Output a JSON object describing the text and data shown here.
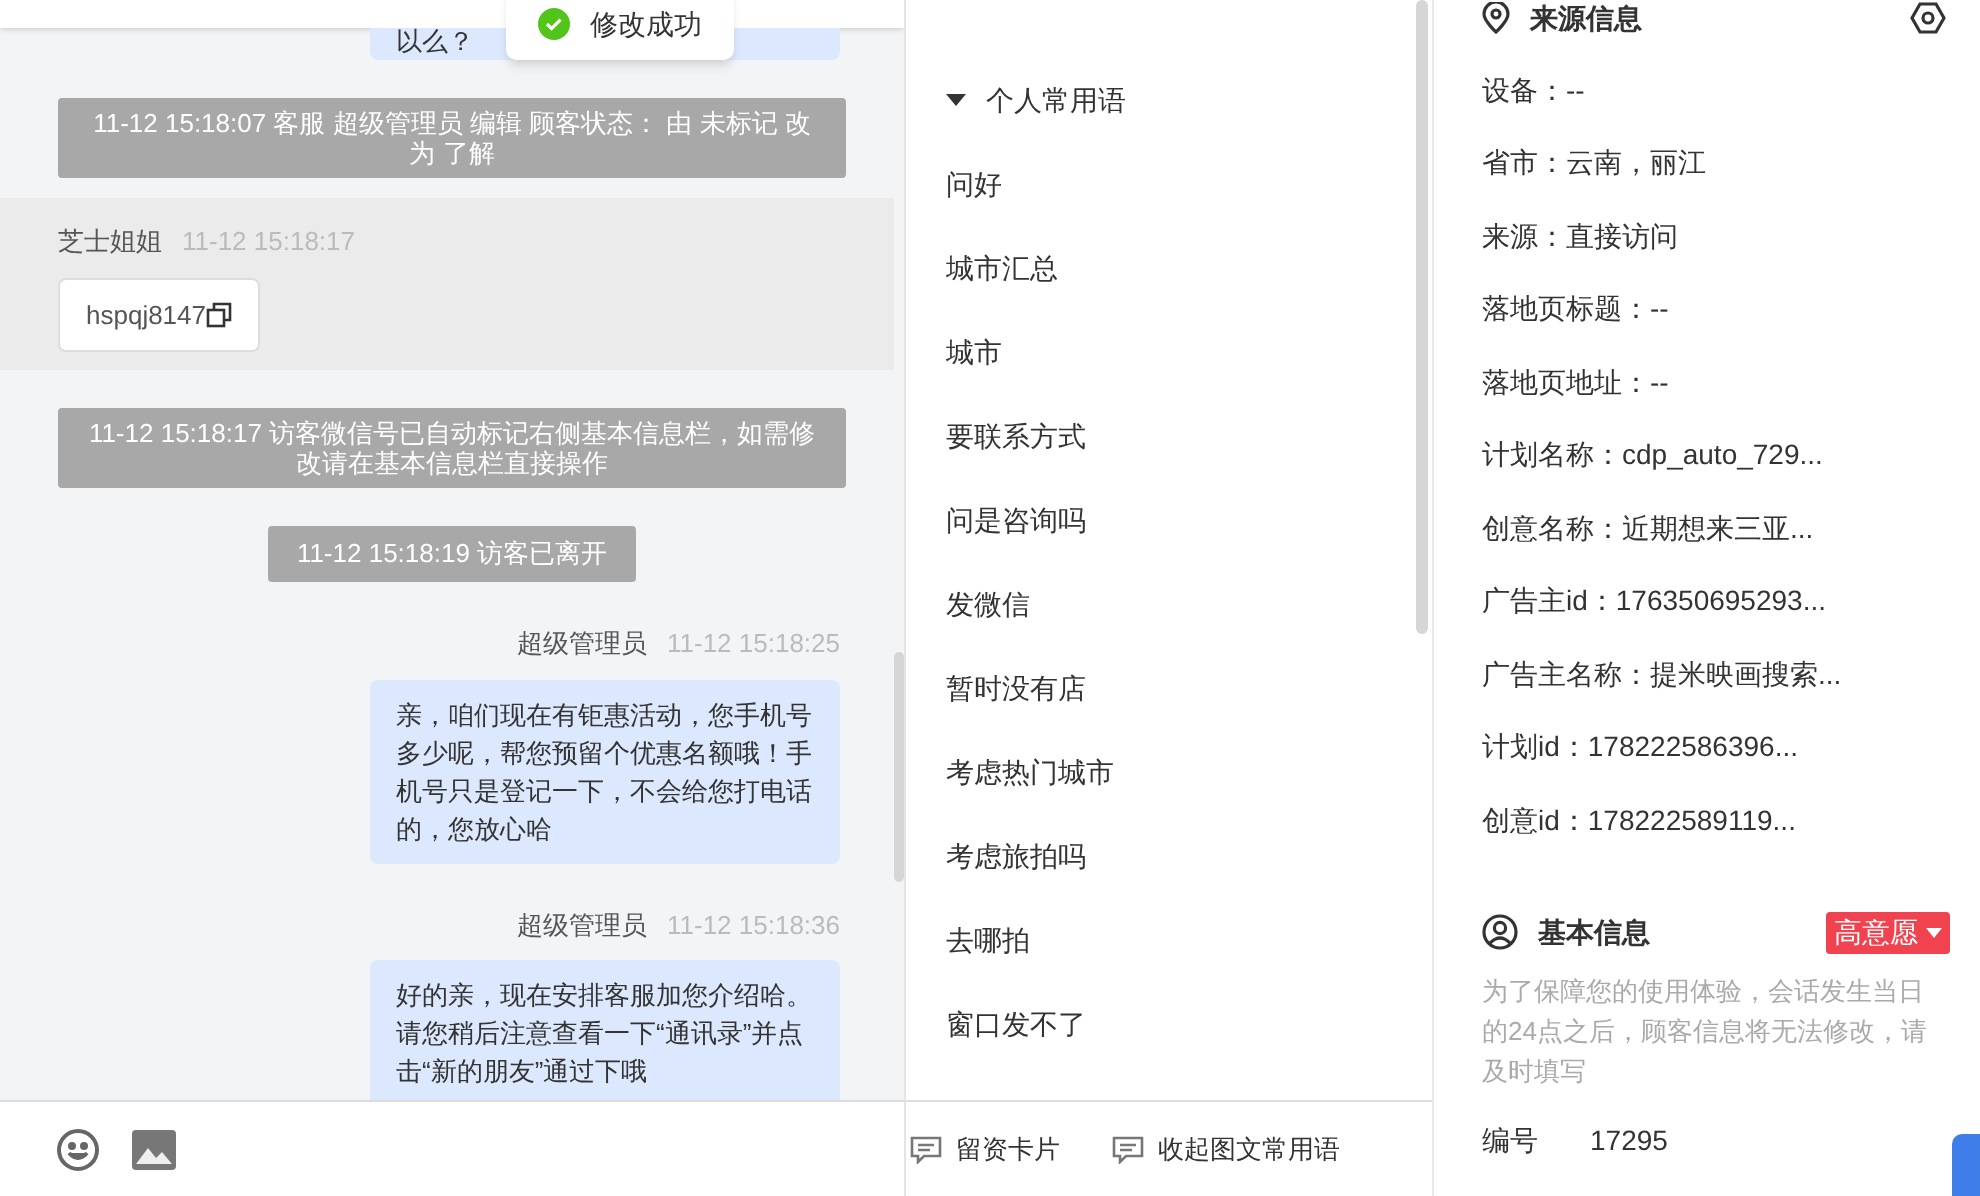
{
  "toast": {
    "text": "修改成功"
  },
  "chat": {
    "messages": [
      {
        "kind": "agent_partial",
        "text": "以么？"
      },
      {
        "kind": "system",
        "text": "11-12 15:18:07 客服 超级管理员 编辑 顾客状态： 由 未标记 改为 了解"
      },
      {
        "kind": "visitor",
        "name": "芝士姐姐",
        "time": "11-12 15:18:17",
        "text": "hspqj8147"
      },
      {
        "kind": "system",
        "text": "11-12 15:18:17 访客微信号已自动标记右侧基本信息栏，如需修改请在基本信息栏直接操作"
      },
      {
        "kind": "notice",
        "text": "11-12 15:18:19 访客已离开"
      },
      {
        "kind": "agent",
        "name": "超级管理员",
        "time": "11-12 15:18:25",
        "text": "亲，咱们现在有钜惠活动，您手机号多少呢，帮您预留个优惠名额哦！手机号只是登记一下，不会给您打电话的，您放心哈"
      },
      {
        "kind": "agent",
        "name": "超级管理员",
        "time": "11-12 15:18:36",
        "text": "好的亲，现在安排客服加您介绍哈。请您稍后注意查看一下“通讯录”并点击“新的朋友”通过下哦"
      }
    ]
  },
  "phrases": {
    "group": {
      "label": "个人常用语",
      "expanded": true
    },
    "items": [
      "问好",
      "城市汇总",
      "城市",
      "要联系方式",
      "问是咨询吗",
      "发微信",
      "暂时没有店",
      "考虑热门城市",
      "考虑旅拍吗",
      "去哪拍",
      "窗口发不了"
    ]
  },
  "toolbar": [
    "留资卡片",
    "收起图文常用语"
  ],
  "source_info": {
    "title": "来源信息",
    "fields": [
      "设备：--",
      "省市：云南，丽江",
      "来源：直接访问",
      "落地页标题：--",
      "落地页地址：--",
      "计划名称：cdp_auto_729...",
      "创意名称：近期想来三亚...",
      "广告主id：176350695293...",
      "广告主名称：提米映画搜索...",
      "计划id：178222586396...",
      "创意id：178222589119..."
    ]
  },
  "basic_info": {
    "title": "基本信息",
    "intent_tag": {
      "label": "高意愿",
      "color": "#f0434f"
    },
    "note": "为了保障您的使用体验，会话发生当日的24点之后，顾客信息将无法修改，请及时填写",
    "fields": [
      {
        "label": "编号",
        "value": "17295"
      }
    ]
  }
}
